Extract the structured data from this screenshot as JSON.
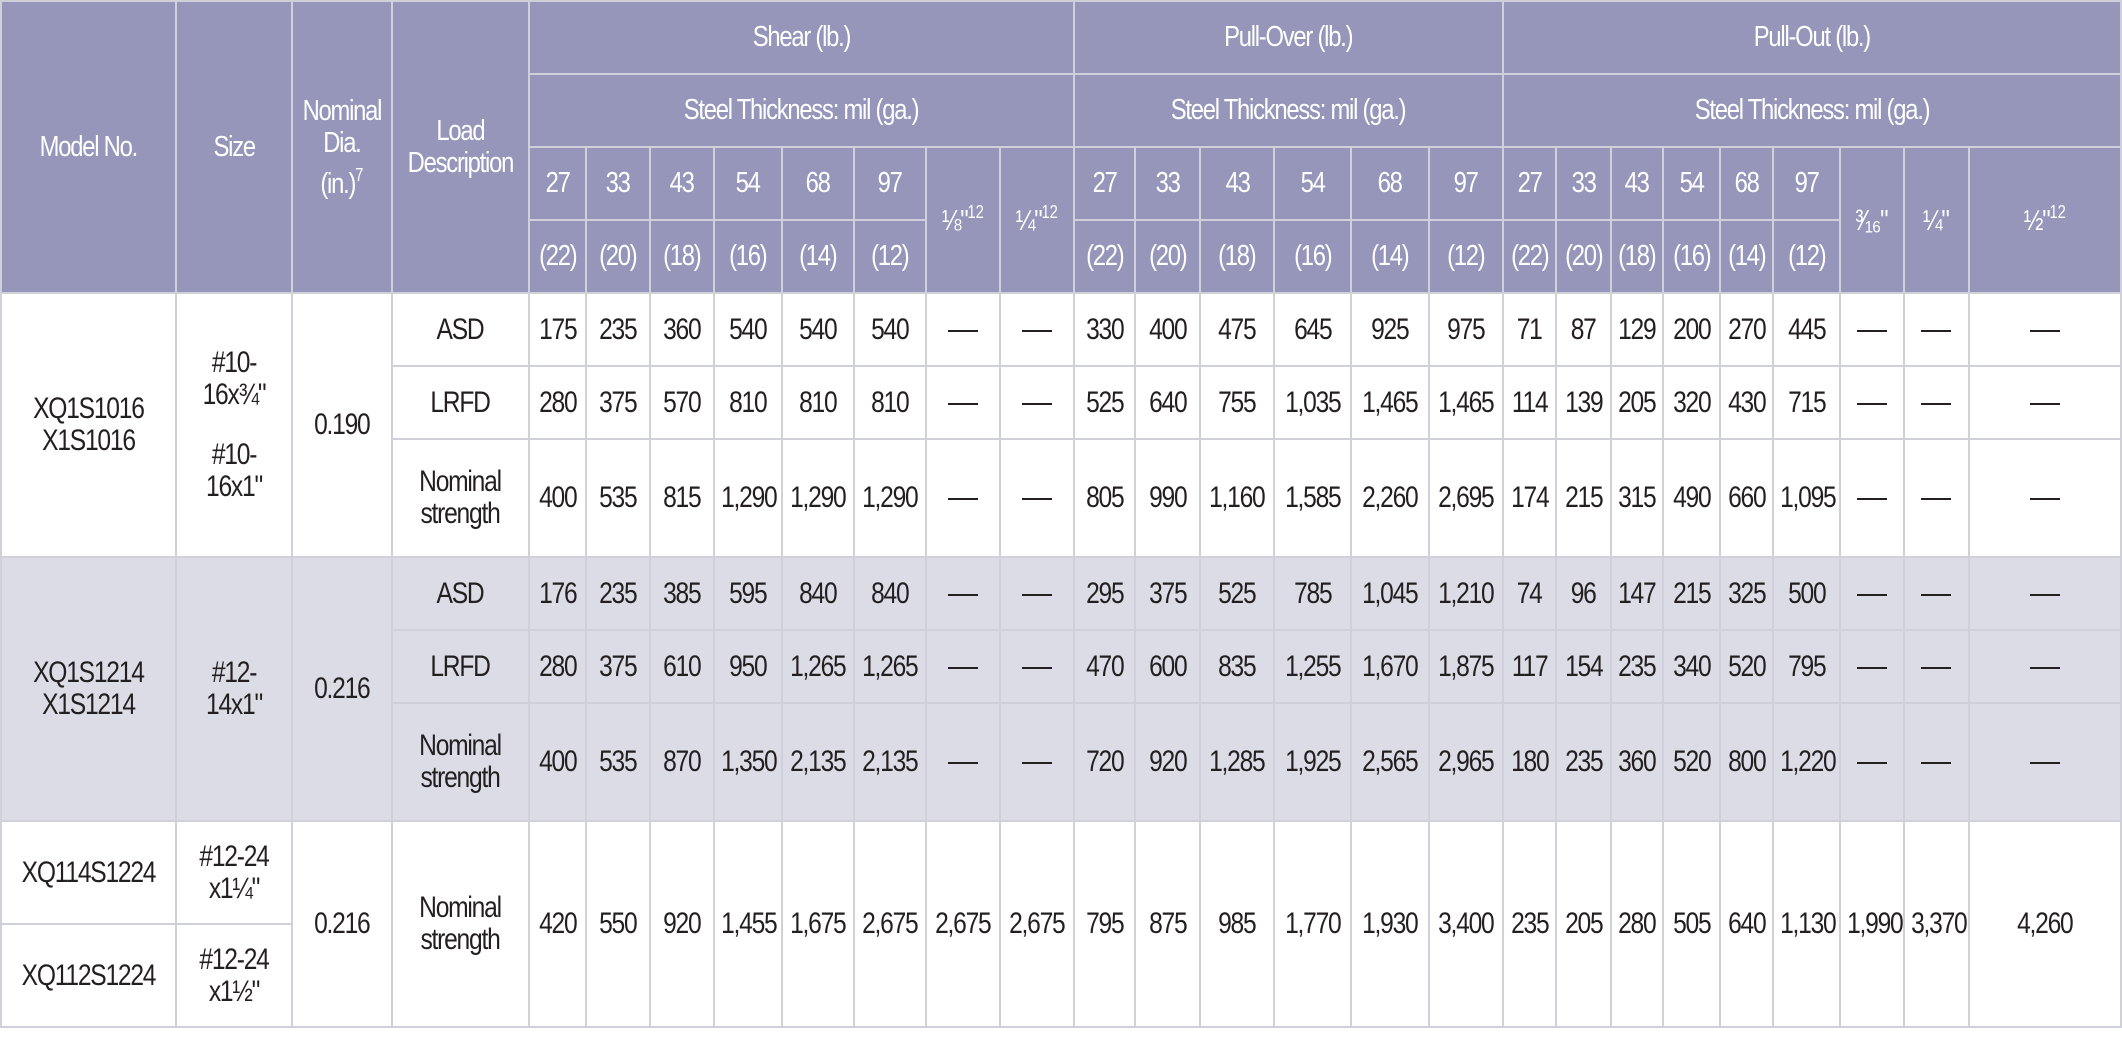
{
  "header": {
    "model": "Model No.",
    "size": "Size",
    "dia": "Nominal Dia. (in.)",
    "dia_sup": "7",
    "load": "Load Description",
    "groups": [
      {
        "title": "Shear (lb.)",
        "subtitle": "Steel Thickness: mil (ga.)",
        "mils": [
          "27",
          "33",
          "43",
          "54",
          "68",
          "97"
        ],
        "gauges": [
          "(22)",
          "(20)",
          "(18)",
          "(16)",
          "(14)",
          "(12)"
        ],
        "extra": [
          {
            "label": "⅛\"",
            "sup": "12"
          },
          {
            "label": "¼\"",
            "sup": "12"
          }
        ]
      },
      {
        "title": "Pull-Over (lb.)",
        "subtitle": "Steel Thickness: mil (ga.)",
        "mils": [
          "27",
          "33",
          "43",
          "54",
          "68",
          "97"
        ],
        "gauges": [
          "(22)",
          "(20)",
          "(18)",
          "(16)",
          "(14)",
          "(12)"
        ],
        "extra": []
      },
      {
        "title": "Pull-Out (lb.)",
        "subtitle": "Steel Thickness: mil (ga.)",
        "mils": [
          "27",
          "33",
          "43",
          "54",
          "68",
          "97"
        ],
        "gauges": [
          "(22)",
          "(20)",
          "(18)",
          "(16)",
          "(14)",
          "(12)"
        ],
        "extra": [
          {
            "label": "³⁄₁₆\"",
            "sup": ""
          },
          {
            "label": "¼\"",
            "sup": ""
          },
          {
            "label": "½\"",
            "sup": "12"
          }
        ]
      }
    ]
  },
  "colors": {
    "header_bg": "#9596b9",
    "shade_bg": "#dcdce6",
    "border": "#cfd0da",
    "text": "#231f20"
  },
  "groups": [
    {
      "models": [
        "XQ1S1016",
        "X1S1016"
      ],
      "sizes": [
        "#10-16x¾\"",
        "#10-16x1\""
      ],
      "dia": "0.190",
      "shaded": false,
      "rows": [
        {
          "load": "ASD",
          "shear": [
            "175",
            "235",
            "360",
            "540",
            "540",
            "540",
            "—",
            "—"
          ],
          "pullover": [
            "330",
            "400",
            "475",
            "645",
            "925",
            "975"
          ],
          "pullout": [
            "71",
            "87",
            "129",
            "200",
            "270",
            "445",
            "—",
            "—",
            "—"
          ]
        },
        {
          "load": "LRFD",
          "shear": [
            "280",
            "375",
            "570",
            "810",
            "810",
            "810",
            "—",
            "—"
          ],
          "pullover": [
            "525",
            "640",
            "755",
            "1,035",
            "1,465",
            "1,465"
          ],
          "pullout": [
            "114",
            "139",
            "205",
            "320",
            "430",
            "715",
            "—",
            "—",
            "—"
          ]
        },
        {
          "load": "Nominal strength",
          "shear": [
            "400",
            "535",
            "815",
            "1,290",
            "1,290",
            "1,290",
            "—",
            "—"
          ],
          "pullover": [
            "805",
            "990",
            "1,160",
            "1,585",
            "2,260",
            "2,695"
          ],
          "pullout": [
            "174",
            "215",
            "315",
            "490",
            "660",
            "1,095",
            "—",
            "—",
            "—"
          ]
        }
      ]
    },
    {
      "models": [
        "XQ1S1214",
        "X1S1214"
      ],
      "sizes": [
        "#12-14x1\""
      ],
      "dia": "0.216",
      "shaded": true,
      "rows": [
        {
          "load": "ASD",
          "shear": [
            "176",
            "235",
            "385",
            "595",
            "840",
            "840",
            "—",
            "—"
          ],
          "pullover": [
            "295",
            "375",
            "525",
            "785",
            "1,045",
            "1,210"
          ],
          "pullout": [
            "74",
            "96",
            "147",
            "215",
            "325",
            "500",
            "—",
            "—",
            "—"
          ]
        },
        {
          "load": "LRFD",
          "shear": [
            "280",
            "375",
            "610",
            "950",
            "1,265",
            "1,265",
            "—",
            "—"
          ],
          "pullover": [
            "470",
            "600",
            "835",
            "1,255",
            "1,670",
            "1,875"
          ],
          "pullout": [
            "117",
            "154",
            "235",
            "340",
            "520",
            "795",
            "—",
            "—",
            "—"
          ]
        },
        {
          "load": "Nominal strength",
          "shear": [
            "400",
            "535",
            "870",
            "1,350",
            "2,135",
            "2,135",
            "—",
            "—"
          ],
          "pullover": [
            "720",
            "920",
            "1,285",
            "1,925",
            "2,565",
            "2,965"
          ],
          "pullout": [
            "180",
            "235",
            "360",
            "520",
            "800",
            "1,220",
            "—",
            "—",
            "—"
          ]
        }
      ]
    },
    {
      "models": [
        "XQ114S1224",
        "XQ112S1224"
      ],
      "sizes": [
        "#12-24x1¼\"",
        "#12-24x1½\""
      ],
      "dia": "0.216",
      "shaded": false,
      "rows": [
        {
          "load": "Nominal strength",
          "shear": [
            "420",
            "550",
            "920",
            "1,455",
            "1,675",
            "2,675",
            "2,675",
            "2,675"
          ],
          "pullover": [
            "795",
            "875",
            "985",
            "1,770",
            "1,930",
            "3,400"
          ],
          "pullout": [
            "235",
            "205",
            "280",
            "505",
            "640",
            "1,130",
            "1,990",
            "3,370",
            "4,260"
          ]
        }
      ]
    }
  ]
}
